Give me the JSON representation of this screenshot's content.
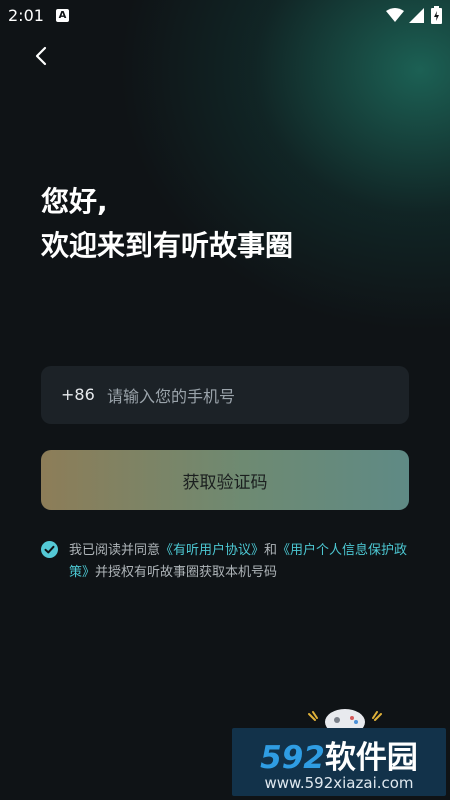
{
  "status_bar": {
    "time": "2:01",
    "notification_badge": "A"
  },
  "greeting": {
    "line1": "您好,",
    "line2": "欢迎来到有听故事圈"
  },
  "phone": {
    "country_code": "+86",
    "placeholder": "请输入您的手机号",
    "value": ""
  },
  "get_code_button": {
    "label": "获取验证码"
  },
  "agreement": {
    "checked": true,
    "prefix": "我已阅读并同意",
    "user_agreement_link": "《有听用户协议》",
    "and": "和",
    "privacy_link": "《用户个人信息保护政策》",
    "suffix": "并授权有听故事圈获取本机号码"
  },
  "watermark": {
    "number": "592",
    "brand": "软件园",
    "url": "www.592xiazai.com"
  },
  "colors": {
    "background": "#0f1316",
    "accent_link": "#4cc7d2",
    "field_bg": "#1c2227"
  }
}
